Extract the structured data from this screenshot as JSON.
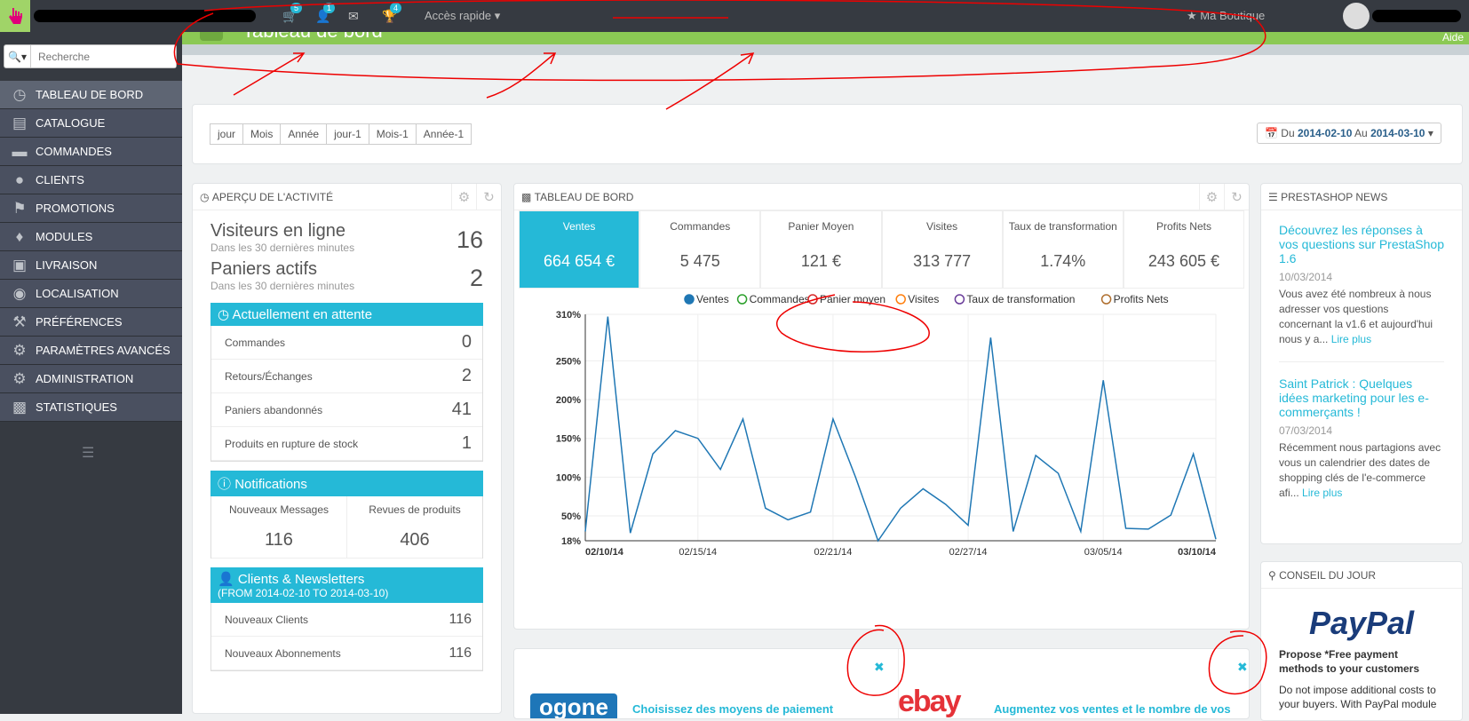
{
  "topbar": {
    "cart_badge": "5",
    "user_badge": "1",
    "trophy_badge": "4",
    "quick_access": "Accès rapide",
    "shop_label": "Ma Boutique"
  },
  "header": {
    "title": "Tableau de bord",
    "help": "Aide"
  },
  "search": {
    "placeholder": "Recherche"
  },
  "sidebar": {
    "items": [
      {
        "label": "TABLEAU DE BORD"
      },
      {
        "label": "CATALOGUE"
      },
      {
        "label": "COMMANDES"
      },
      {
        "label": "CLIENTS"
      },
      {
        "label": "PROMOTIONS"
      },
      {
        "label": "MODULES"
      },
      {
        "label": "LIVRAISON"
      },
      {
        "label": "LOCALISATION"
      },
      {
        "label": "PRÉFÉRENCES"
      },
      {
        "label": "PARAMÈTRES AVANCÉS"
      },
      {
        "label": "ADMINISTRATION"
      },
      {
        "label": "STATISTIQUES"
      }
    ]
  },
  "range_buttons": [
    "jour",
    "Mois",
    "Année",
    "jour-1",
    "Mois-1",
    "Année-1"
  ],
  "daterange": {
    "du": "Du",
    "from": "2014-02-10",
    "au": "Au",
    "to": "2014-03-10"
  },
  "activity": {
    "title": "APERÇU DE L'ACTIVITÉ",
    "visitors_label": "Visiteurs en ligne",
    "visitors_sub": "Dans les 30 dernières minutes",
    "visitors_value": "16",
    "carts_label": "Paniers actifs",
    "carts_sub": "Dans les 30 dernières minutes",
    "carts_value": "2",
    "pending_title": "Actuellement en attente",
    "pending": [
      {
        "label": "Commandes",
        "value": "0"
      },
      {
        "label": "Retours/Échanges",
        "value": "2"
      },
      {
        "label": "Paniers abandonnés",
        "value": "41"
      },
      {
        "label": "Produits en rupture de stock",
        "value": "1"
      }
    ],
    "notifications_title": "Notifications",
    "notif_messages_label": "Nouveaux Messages",
    "notif_messages_value": "116",
    "notif_reviews_label": "Revues de produits",
    "notif_reviews_value": "406",
    "clients_title": "Clients & Newsletters",
    "clients_range": "(FROM 2014-02-10 TO 2014-03-10)",
    "clients": [
      {
        "label": "Nouveaux Clients",
        "value": "116"
      },
      {
        "label": "Nouveaux Abonnements",
        "value": "116"
      }
    ]
  },
  "dashboard": {
    "title": "TABLEAU DE BORD",
    "kpis": [
      {
        "label": "Ventes",
        "value": "664 654 €"
      },
      {
        "label": "Commandes",
        "value": "5 475"
      },
      {
        "label": "Panier Moyen",
        "value": "121 €"
      },
      {
        "label": "Visites",
        "value": "313 777"
      },
      {
        "label": "Taux de transformation",
        "value": "1.74%"
      },
      {
        "label": "Profits Nets",
        "value": "243 605 €"
      }
    ]
  },
  "chart_data": {
    "type": "line",
    "series_legend": [
      {
        "name": "Ventes",
        "color": "#1f77b4",
        "filled": true
      },
      {
        "name": "Commandes",
        "color": "#2ca02c",
        "filled": false
      },
      {
        "name": "Panier moyen",
        "color": "#d62728",
        "filled": false
      },
      {
        "name": "Visites",
        "color": "#ff7f0e",
        "filled": false
      },
      {
        "name": "Taux de transformation",
        "color": "#6a3d9a",
        "filled": false
      },
      {
        "name": "Profits Nets",
        "color": "#b07030",
        "filled": false
      }
    ],
    "x": [
      "02/10/14",
      "02/11/14",
      "02/12/14",
      "02/13/14",
      "02/14/14",
      "02/15/14",
      "02/16/14",
      "02/17/14",
      "02/18/14",
      "02/19/14",
      "02/20/14",
      "02/21/14",
      "02/22/14",
      "02/23/14",
      "02/24/14",
      "02/25/14",
      "02/26/14",
      "02/27/14",
      "02/28/14",
      "03/01/14",
      "03/02/14",
      "03/03/14",
      "03/04/14",
      "03/05/14",
      "03/06/14",
      "03/07/14",
      "03/08/14",
      "03/09/14",
      "03/10/14"
    ],
    "series": [
      {
        "name": "Ventes",
        "values": [
          30,
          307,
          28,
          130,
          160,
          150,
          110,
          175,
          60,
          45,
          55,
          175,
          100,
          18,
          60,
          85,
          65,
          38,
          280,
          30,
          128,
          105,
          30,
          225,
          34,
          33,
          51,
          130,
          20
        ]
      }
    ],
    "xticks": [
      "02/10/14",
      "02/15/14",
      "02/21/14",
      "02/27/14",
      "03/05/14",
      "03/10/14"
    ],
    "yticks": [
      "310%",
      "250%",
      "200%",
      "150%",
      "100%",
      "50%",
      "18%"
    ],
    "ylim": [
      18,
      310
    ]
  },
  "news": {
    "title": "PRESTASHOP NEWS",
    "items": [
      {
        "title": "Découvrez les réponses à vos questions sur PrestaShop 1.6",
        "date": "10/03/2014",
        "text": "Vous avez été nombreux à nous adresser vos questions concernant la v1.6 et aujourd'hui nous y a...",
        "more": "Lire plus"
      },
      {
        "title": "Saint Patrick : Quelques idées marketing pour les e-commerçants !",
        "date": "07/03/2014",
        "text": "Récemment nous partagions avec vous un calendrier des dates de shopping clés de l'e-commerce afi...",
        "more": "Lire plus"
      }
    ]
  },
  "tip": {
    "title": "CONSEIL DU JOUR",
    "brand": "PayPal",
    "headline": "Propose *Free payment methods to your customers",
    "text": "Do not impose additional costs to your buyers. With PayPal module"
  },
  "promos": [
    {
      "brand": "ogone",
      "text": "Choisissez des moyens de paiement"
    },
    {
      "brand": "ebay",
      "text": "Augmentez vos ventes et le nombre de vos"
    }
  ]
}
